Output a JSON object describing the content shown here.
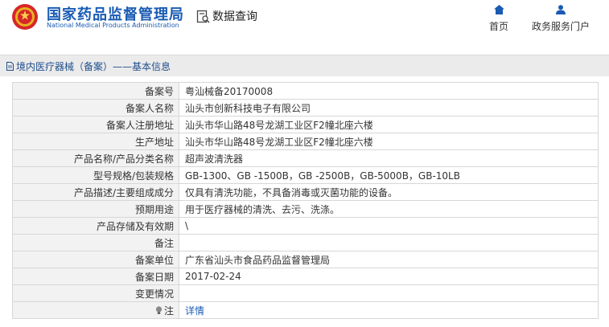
{
  "header": {
    "brand_cn": "国家药品监督管理局",
    "brand_en": "National Medical Products Administration",
    "query_title": "数据查询",
    "nav": {
      "home": "首页",
      "portal": "政务服务门户"
    }
  },
  "section": {
    "title": "境内医疗器械（备案）——基本信息"
  },
  "rows": [
    {
      "label": "备案号",
      "value": "粤汕械备20170008"
    },
    {
      "label": "备案人名称",
      "value": "汕头市创新科技电子有限公司"
    },
    {
      "label": "备案人注册地址",
      "value": "汕头市华山路48号龙湖工业区F2幢北座六楼"
    },
    {
      "label": "生产地址",
      "value": "汕头市华山路48号龙湖工业区F2幢北座六楼"
    },
    {
      "label": "产品名称/产品分类名称",
      "value": "超声波清洗器"
    },
    {
      "label": "型号规格/包装规格",
      "value": "GB-1300、GB -1500B，GB -2500B，GB-5000B，GB-10LB"
    },
    {
      "label": "产品描述/主要组成成分",
      "value": "仅具有清洗功能，不具备消毒或灭菌功能的设备。"
    },
    {
      "label": "预期用途",
      "value": "用于医疗器械的清洗、去污、洗涤。"
    },
    {
      "label": "产品存储及有效期",
      "value": "\\"
    },
    {
      "label": "备注",
      "value": ""
    },
    {
      "label": "备案单位",
      "value": "广东省汕头市食品药品监督管理局"
    },
    {
      "label": "备案日期",
      "value": "2017-02-24"
    },
    {
      "label": "变更情况",
      "value": ""
    }
  ],
  "note_row": {
    "label": "注",
    "link": "详情"
  },
  "colors": {
    "brand_blue": "#1a5bb3",
    "label_bg": "#f2f2f2",
    "section_bg": "#ebebeb"
  }
}
